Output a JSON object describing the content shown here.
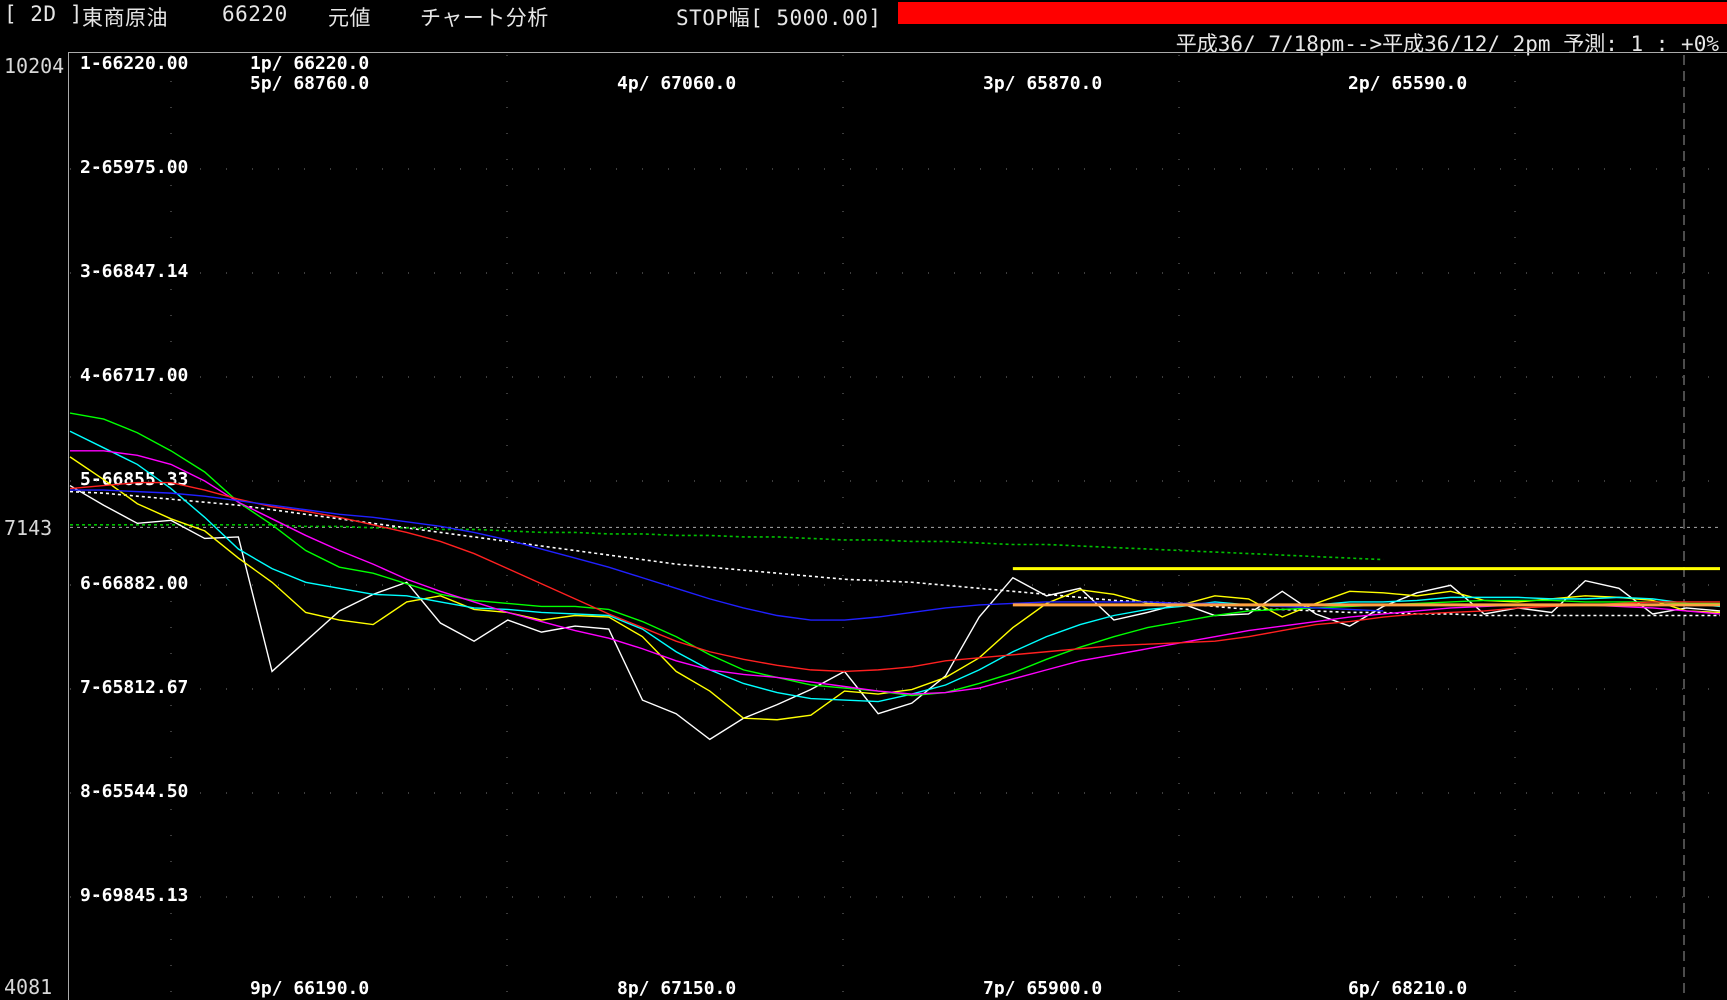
{
  "header": {
    "period": "[ 2D ]",
    "instrument": "東商原油",
    "price": "66220",
    "mode": "元値",
    "tool": "チャート分析",
    "stop": "STOP幅[ 5000.00]",
    "info": "平成36/ 7/18pm-->平成36/12/ 2pm 予測: 1 : +0%"
  },
  "colors": {
    "stop_bar": "#ff0000",
    "background": "#000000"
  },
  "chart_data": {
    "type": "line",
    "y_axis_labels": {
      "top": "10204",
      "mid": "7143",
      "bottom": "4081"
    },
    "ylim": [
      4081,
      10204
    ],
    "levels": [
      {
        "label": "1-66220.00"
      },
      {
        "label": "2-65975.00"
      },
      {
        "label": "3-66847.14"
      },
      {
        "label": "4-66717.00"
      },
      {
        "label": "5-66855.33"
      },
      {
        "label": "6-66882.00"
      },
      {
        "label": "7-65812.67"
      },
      {
        "label": "8-65544.50"
      },
      {
        "label": "9-69845.13"
      }
    ],
    "points": {
      "p1": "1p/ 66220.0",
      "p5": "5p/ 68760.0",
      "p4": "4p/ 67060.0",
      "p3": "3p/ 65870.0",
      "p2": "2p/ 65590.0",
      "p9": "9p/ 66190.0",
      "p8": "8p/ 67150.0",
      "p7": "7p/ 65900.0",
      "p6": "6p/ 68210.0"
    },
    "x": [
      0,
      1,
      2,
      3,
      4,
      5,
      6,
      7,
      8,
      9,
      10,
      11,
      12,
      13,
      14,
      15,
      16,
      17,
      18,
      19,
      20,
      21,
      22,
      23,
      24,
      25,
      26,
      27,
      28,
      29,
      30,
      31,
      32,
      33,
      34,
      35,
      36,
      37,
      38,
      39,
      40,
      41,
      42,
      43,
      44,
      45,
      46,
      47,
      48,
      49
    ],
    "series": [
      {
        "color": "#ffffff",
        "values": [
          7420,
          7290,
          7170,
          7190,
          7070,
          7080,
          6190,
          6390,
          6590,
          6700,
          6780,
          6510,
          6390,
          6530,
          6450,
          6490,
          6470,
          6000,
          5910,
          5740,
          5880,
          5970,
          6070,
          6190,
          5910,
          5980,
          6160,
          6550,
          6810,
          6690,
          6740,
          6530,
          6580,
          6640,
          6560,
          6570,
          6720,
          6570,
          6490,
          6620,
          6710,
          6760,
          6570,
          6610,
          6580,
          6790,
          6740,
          6570,
          6610,
          6590
        ]
      },
      {
        "color": "#ffff00",
        "values": [
          7610,
          7460,
          7300,
          7200,
          7120,
          6940,
          6780,
          6580,
          6530,
          6500,
          6650,
          6690,
          6600,
          6580,
          6530,
          6560,
          6550,
          6420,
          6190,
          6060,
          5880,
          5870,
          5900,
          6060,
          6040,
          6070,
          6150,
          6280,
          6480,
          6640,
          6730,
          6700,
          6640,
          6630,
          6690,
          6670,
          6550,
          6640,
          6720,
          6710,
          6690,
          6720,
          6660,
          6650,
          6670,
          6690,
          6680,
          6660,
          6590,
          6580
        ]
      },
      {
        "color": "#00ffff",
        "values": [
          7780,
          7670,
          7560,
          7400,
          7210,
          7000,
          6870,
          6780,
          6740,
          6700,
          6690,
          6650,
          6610,
          6600,
          6580,
          6570,
          6560,
          6470,
          6320,
          6200,
          6110,
          6050,
          6010,
          6000,
          5990,
          6040,
          6100,
          6200,
          6320,
          6420,
          6500,
          6560,
          6600,
          6620,
          6650,
          6630,
          6620,
          6630,
          6650,
          6650,
          6660,
          6680,
          6680,
          6680,
          6670,
          6670,
          6680,
          6670,
          6640,
          6620
        ]
      },
      {
        "color": "#00ff00",
        "values": [
          7900,
          7860,
          7770,
          7650,
          7510,
          7310,
          7160,
          6990,
          6880,
          6840,
          6770,
          6700,
          6660,
          6640,
          6620,
          6620,
          6600,
          6520,
          6420,
          6300,
          6200,
          6150,
          6100,
          6080,
          6060,
          6030,
          6050,
          6110,
          6180,
          6270,
          6350,
          6420,
          6480,
          6520,
          6560,
          6590,
          6600,
          6610,
          6620,
          6630,
          6640,
          6650,
          6660,
          6660,
          6660,
          6650,
          6650,
          6650,
          6640,
          6640
        ]
      },
      {
        "color": "#ff00ff",
        "values": [
          7650,
          7650,
          7620,
          7560,
          7450,
          7310,
          7200,
          7090,
          6990,
          6900,
          6800,
          6720,
          6650,
          6580,
          6520,
          6460,
          6410,
          6340,
          6260,
          6200,
          6170,
          6150,
          6120,
          6090,
          6060,
          6040,
          6050,
          6080,
          6140,
          6200,
          6260,
          6300,
          6340,
          6380,
          6420,
          6460,
          6490,
          6520,
          6550,
          6570,
          6590,
          6610,
          6620,
          6630,
          6630,
          6630,
          6620,
          6610,
          6590,
          6570
        ]
      },
      {
        "color": "#ff2020",
        "values": [
          7400,
          7420,
          7440,
          7440,
          7390,
          7330,
          7280,
          7250,
          7210,
          7160,
          7110,
          7050,
          6970,
          6870,
          6770,
          6670,
          6570,
          6480,
          6390,
          6320,
          6270,
          6230,
          6200,
          6190,
          6200,
          6220,
          6260,
          6280,
          6300,
          6320,
          6340,
          6360,
          6370,
          6380,
          6390,
          6420,
          6460,
          6500,
          6520,
          6550,
          6570,
          6580,
          6590,
          6610,
          6620,
          6630,
          6640,
          6650,
          6650,
          6650
        ]
      },
      {
        "color": "#2020ff",
        "values": [
          7390,
          7390,
          7380,
          7370,
          7350,
          7320,
          7290,
          7260,
          7230,
          7210,
          7180,
          7150,
          7110,
          7060,
          7000,
          6940,
          6880,
          6810,
          6740,
          6670,
          6610,
          6560,
          6530,
          6530,
          6550,
          6580,
          6610,
          6630,
          6640,
          6650,
          6650,
          6650,
          6650,
          6640,
          6640,
          6630,
          6620,
          6610,
          6600,
          6590
        ]
      }
    ],
    "dashed_series": [
      {
        "color": "#ffffff",
        "values": [
          7380,
          7370,
          7350,
          7330,
          7310,
          7290,
          7260,
          7230,
          7200,
          7170,
          7140,
          7110,
          7080,
          7050,
          7020,
          6990,
          6960,
          6930,
          6900,
          6880,
          6860,
          6840,
          6820,
          6800,
          6790,
          6780,
          6760,
          6740,
          6720,
          6700,
          6680,
          6660,
          6650,
          6640,
          6620,
          6600,
          6600,
          6590,
          6580,
          6580,
          6570,
          6570,
          6560,
          6560,
          6560,
          6560,
          6560,
          6560,
          6560,
          6560
        ]
      },
      {
        "color": "#00c000",
        "values": [
          7160,
          7160,
          7160,
          7160,
          7160,
          7160,
          7160,
          7150,
          7150,
          7140,
          7140,
          7130,
          7130,
          7120,
          7110,
          7110,
          7100,
          7100,
          7090,
          7090,
          7080,
          7080,
          7070,
          7060,
          7060,
          7050,
          7050,
          7040,
          7030,
          7030,
          7020,
          7010,
          7000,
          6990,
          6980,
          6970,
          6960,
          6950,
          6940,
          6930
        ]
      }
    ],
    "hlines": [
      {
        "color": "#ffff00",
        "value": 6870,
        "x_start": 28,
        "x_end": 49
      },
      {
        "color": "#ffa040",
        "value": 6630,
        "x_start": 28,
        "x_end": 49
      }
    ],
    "grid": true
  }
}
